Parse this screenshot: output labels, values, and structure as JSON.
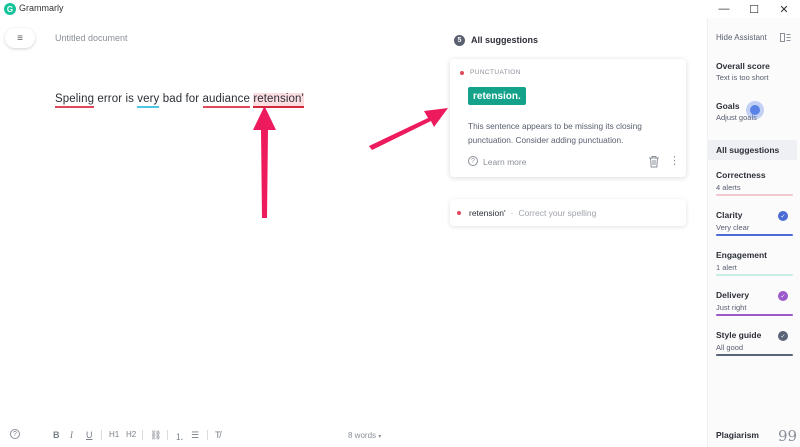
{
  "window": {
    "title": "Grammarly",
    "logo_letter": "G",
    "minimize": "—",
    "maximize": "☐",
    "close": "✕"
  },
  "editor": {
    "menu_icon": "≡",
    "doc_title": "Untitled document",
    "words": [
      "Speling",
      "error",
      "is",
      "very",
      "bad",
      "for",
      "audiance",
      "retension'"
    ],
    "word_count": "8 words",
    "word_count_caret": "▾"
  },
  "suggestions": {
    "count": "5",
    "title": "All suggestions",
    "card": {
      "category": "PUNCTUATION",
      "fix": "retension.",
      "description": "This sentence appears to be missing its closing punctuation. Consider adding punctuation.",
      "learn_icon": "?",
      "learn_more": "Learn more",
      "more_icon": "⋮"
    },
    "collapsed": {
      "word": "retension'",
      "separator": "·",
      "description": "Correct your spelling"
    }
  },
  "sidebar": {
    "hide_assistant": "Hide Assistant",
    "overall_score_label": "Overall score",
    "overall_score_value": "Text is too short",
    "goals_label": "Goals",
    "goals_value": "Adjust goals",
    "all_suggestions": "All suggestions",
    "categories": [
      {
        "label": "Correctness",
        "status": "4 alerts",
        "color": "#f2c7cd",
        "checked": false
      },
      {
        "label": "Clarity",
        "status": "Very clear",
        "color": "#4a6cd4",
        "checked": true
      },
      {
        "label": "Engagement",
        "status": "1 alert",
        "color": "#c9ece4",
        "checked": false
      },
      {
        "label": "Delivery",
        "status": "Just right",
        "color": "#9b59c9",
        "checked": true
      },
      {
        "label": "Style guide",
        "status": "All good",
        "color": "#5a6478",
        "checked": true
      }
    ],
    "plagiarism": "Plagiarism",
    "plagiarism_icon": "99",
    "check_glyph": "✓"
  },
  "toolbar": {
    "help": "?",
    "bold": "B",
    "italic": "I",
    "underline": "U",
    "h1": "H1",
    "h2": "H2",
    "link": "⛓",
    "ordered_list": "⒈",
    "bullet_list": "☰",
    "clear_format": "T̸"
  },
  "colors": {
    "brand": "#15c39a",
    "fix_button": "#14a38a",
    "arrow": "#ee1a5e",
    "error_underline": "#e0485c",
    "clarity_underline": "#4ec7e4"
  }
}
